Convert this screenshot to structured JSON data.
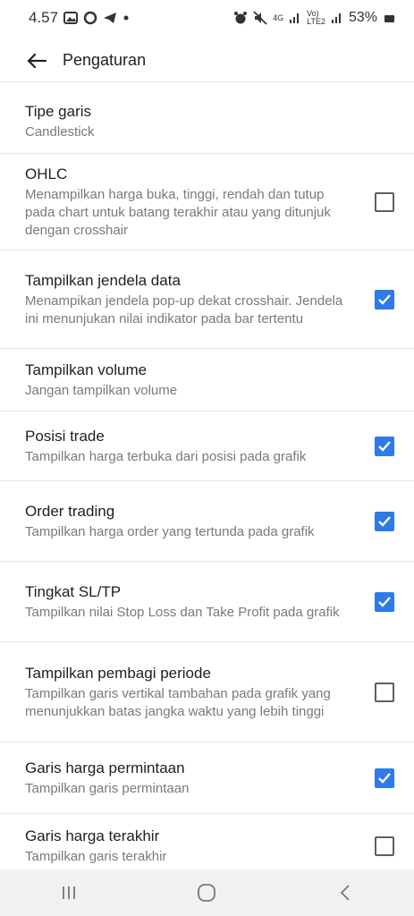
{
  "status_bar": {
    "time": "4.57",
    "network_top": "4G",
    "network_volte": "Vo)",
    "network_lte": "LTE2",
    "battery_percent": "53%"
  },
  "app_bar": {
    "title": "Pengaturan"
  },
  "settings": [
    {
      "title": "Tipe garis",
      "description": "Candlestick",
      "has_checkbox": false
    },
    {
      "title": "OHLC",
      "description": "Menampilkan harga buka, tinggi, rendah dan tutup pada chart untuk batang terakhir atau yang ditunjuk dengan crosshair",
      "has_checkbox": true,
      "checked": false
    },
    {
      "title": "Tampilkan jendela data",
      "description": "Menampikan jendela pop-up dekat crosshair. Jendela ini menunjukan nilai indikator pada bar tertentu",
      "has_checkbox": true,
      "checked": true
    },
    {
      "title": "Tampilkan volume",
      "description": "Jangan tampilkan volume",
      "has_checkbox": false
    },
    {
      "title": "Posisi trade",
      "description": "Tampilkan harga terbuka dari posisi pada grafik",
      "has_checkbox": true,
      "checked": true
    },
    {
      "title": "Order trading",
      "description": "Tampilkan harga order yang tertunda pada grafik",
      "has_checkbox": true,
      "checked": true
    },
    {
      "title": "Tingkat SL/TP",
      "description": "Tampilkan nilai Stop Loss dan Take Profit pada grafik",
      "has_checkbox": true,
      "checked": true
    },
    {
      "title": "Tampilkan pembagi periode",
      "description": "Tampilkan garis vertikal tambahan pada grafik yang menunjukkan batas jangka waktu yang lebih tinggi",
      "has_checkbox": true,
      "checked": false
    },
    {
      "title": "Garis harga permintaan",
      "description": "Tampilkan garis permintaan",
      "has_checkbox": true,
      "checked": true
    },
    {
      "title": "Garis harga terakhir",
      "description": "Tampilkan garis terakhir",
      "has_checkbox": true,
      "checked": false
    }
  ],
  "colors": {
    "accent": "#2f7ae6",
    "nav_background": "#f1f1f1"
  },
  "icons": {
    "back": "arrow-left-icon",
    "nav_recents": "recents-icon",
    "nav_home": "home-icon",
    "nav_back": "chevron-left-icon"
  }
}
